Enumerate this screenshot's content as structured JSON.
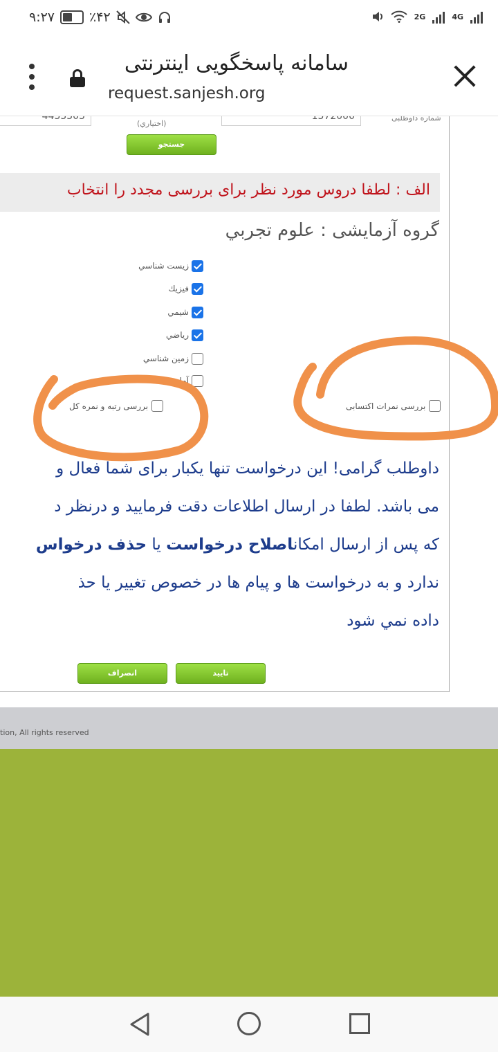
{
  "status_bar": {
    "time": "۹:۲۷",
    "battery": "٪۴۲",
    "net1": "2G",
    "net2": "4G"
  },
  "browser": {
    "title": "سامانه پاسخگویی اینترنتی",
    "url": "request.sanjesh.org"
  },
  "form": {
    "field_left_value": "4455505",
    "optional_label": "(اختياري)",
    "field_right_value": "1572000",
    "candidate_label": "شماره داوطلبی",
    "search_button": "جستجو"
  },
  "notice": "الف : لطفا دروس مورد نظر برای بررسی مجدد را انتخاب",
  "group_title": "گروه آزمایشی : علوم تجربي",
  "subjects": [
    {
      "label": "زيست شناسي",
      "checked": true
    },
    {
      "label": "فيزيك",
      "checked": true
    },
    {
      "label": "شيمي",
      "checked": true
    },
    {
      "label": "رياضي",
      "checked": true
    },
    {
      "label": "زمين شناسي",
      "checked": false
    },
    {
      "label": "آمار",
      "checked": false
    }
  ],
  "options": {
    "rank_label": "بررسی رتبه و نمره کل",
    "grades_label": "بررسی نمرات اکتسابی"
  },
  "message": {
    "line1_a": "داوطلب گرامی",
    "line1_b": "! این درخواست تنها یکبار برای شما فعال و",
    "line2": "می باشد. لطفا در ارسال اطلاعات دقت فرمایید و درنظر د",
    "line3_a": "که پس از ارسال امکان",
    "line3_b": "اصلاح درخواست",
    "line3_c": " یا ",
    "line3_d": "حذف درخواس",
    "line4": "ندارد و به درخواست ها و پیام ها در خصوص تغییر یا حذ",
    "line5": "داده نمي شود"
  },
  "buttons": {
    "confirm": "تایید",
    "cancel": "انصراف"
  },
  "footer": "tion, All rights reserved",
  "colors": {
    "annotation": "#f0914a",
    "olive": "#9cb33a",
    "notice_red": "#c0141c",
    "message_blue": "#1d3c8c"
  }
}
